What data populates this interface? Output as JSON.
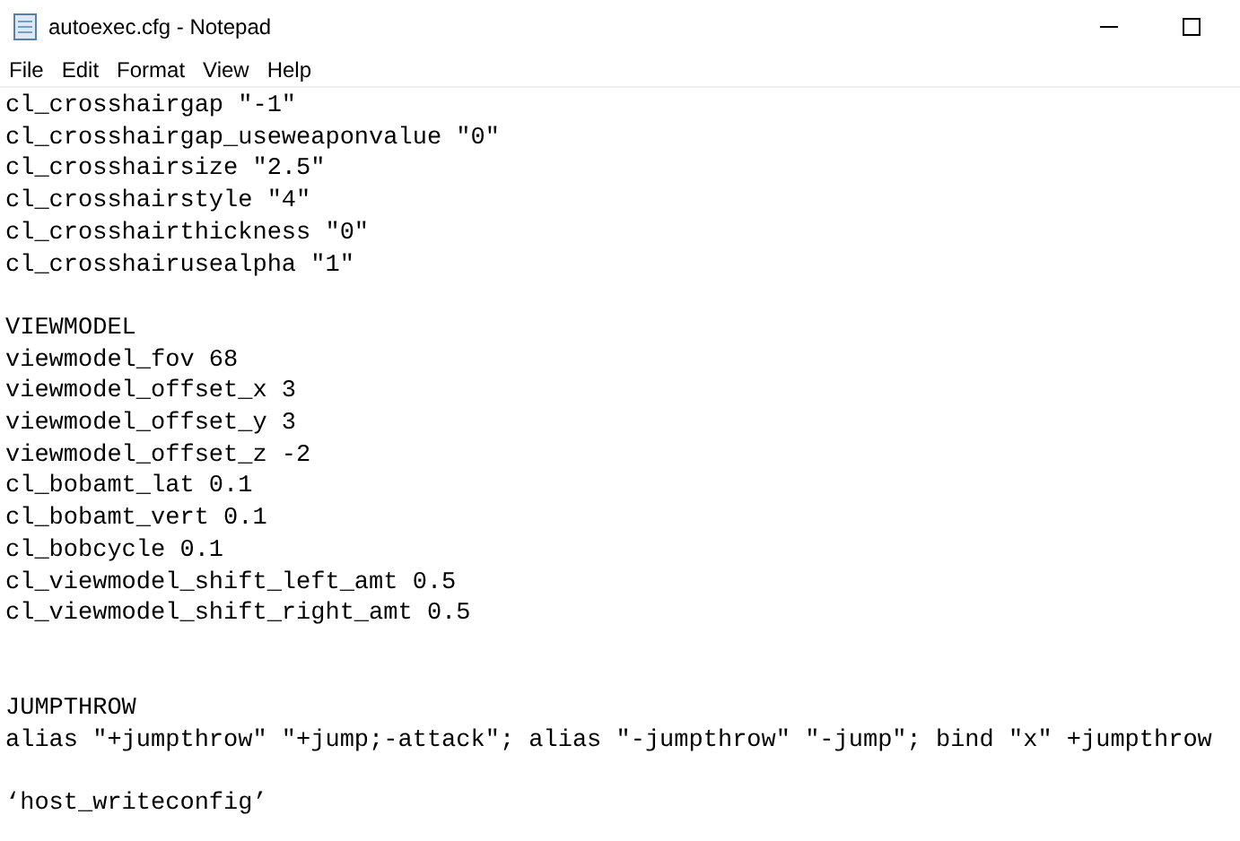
{
  "window": {
    "title": "autoexec.cfg - Notepad"
  },
  "menu": [
    "File",
    "Edit",
    "Format",
    "View",
    "Help"
  ],
  "lines": [
    {
      "kind": "text",
      "text": "cl_crosshairgap \"-1\""
    },
    {
      "kind": "text",
      "text": "cl_crosshairgap_useweaponvalue \"0\""
    },
    {
      "kind": "text",
      "text": "cl_crosshairsize \"2.5\""
    },
    {
      "kind": "text",
      "text": "cl_crosshairstyle \"4\""
    },
    {
      "kind": "text",
      "text": "cl_crosshairthickness \"0\""
    },
    {
      "kind": "text",
      "text": "cl_crosshairusealpha \"1\""
    },
    {
      "kind": "blank"
    },
    {
      "kind": "text",
      "text": "VIEWMODEL"
    },
    {
      "kind": "text",
      "text": "viewmodel_fov 68"
    },
    {
      "kind": "text",
      "text": "viewmodel_offset_x 3"
    },
    {
      "kind": "text",
      "text": "viewmodel_offset_y 3"
    },
    {
      "kind": "text",
      "text": "viewmodel_offset_z -2"
    },
    {
      "kind": "text",
      "text": "cl_bobamt_lat 0.1"
    },
    {
      "kind": "text",
      "text": "cl_bobamt_vert 0.1"
    },
    {
      "kind": "text",
      "text": "cl_bobcycle 0.1"
    },
    {
      "kind": "text",
      "text": "cl_viewmodel_shift_left_amt 0.5"
    },
    {
      "kind": "text",
      "text": "cl_viewmodel_shift_right_amt 0.5"
    },
    {
      "kind": "blank"
    },
    {
      "kind": "blank"
    },
    {
      "kind": "text",
      "text": "JUMPTHROW"
    },
    {
      "kind": "text",
      "text": "alias \"+jumpthrow\" \"+jump;-attack\"; alias \"-jumpthrow\" \"-jump\"; bind \"x\" +jumpthrow"
    },
    {
      "kind": "blank"
    },
    {
      "kind": "text",
      "text": "‘host_writeconfig’"
    }
  ]
}
